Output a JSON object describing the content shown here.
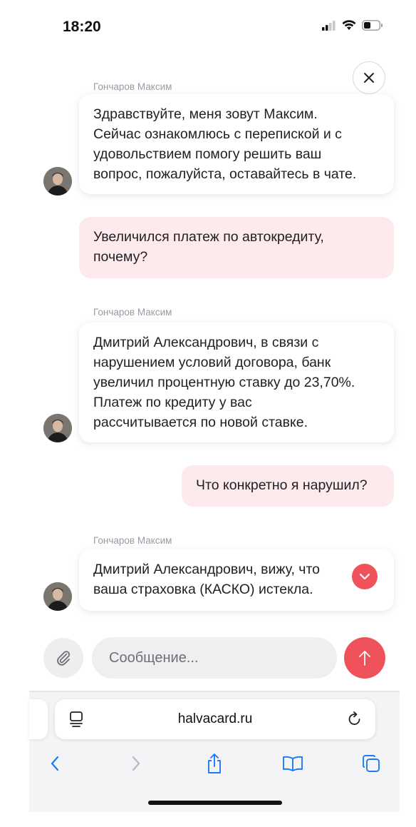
{
  "status_bar": {
    "time": "18:20"
  },
  "chat": {
    "messages": [
      {
        "direction": "in",
        "sender": "Гончаров Максим",
        "lines": [
          "Здравствуйте, меня зовут Максим.",
          "Сейчас ознакомлюсь с перепиской и с",
          "удовольствием помогу решить ваш",
          "вопрос, пожалуйста, оставайтесь в чате."
        ]
      },
      {
        "direction": "out",
        "lines": [
          "Увеличился платеж по автокредиту,",
          "почему?"
        ]
      },
      {
        "direction": "in",
        "sender": "Гончаров Максим",
        "lines": [
          "Дмитрий Александрович, в связи с",
          "нарушением условий договора, банк",
          "увеличил процентную ставку до 23,70%.",
          "Платеж по кредиту у вас",
          "рассчитывается по новой ставке."
        ]
      },
      {
        "direction": "out",
        "lines": [
          "Что конкретно я нарушил?"
        ]
      },
      {
        "direction": "in",
        "sender": "Гончаров Максим",
        "lines": [
          "Дмитрий Александрович, вижу, что",
          "ваша страховка (КАСКО) истекла."
        ]
      }
    ],
    "input": {
      "placeholder": "Сообщение...",
      "value": ""
    },
    "icons": {
      "close": "close-icon",
      "attach": "paperclip-icon",
      "send": "arrow-up-icon",
      "scroll": "chevron-down-icon"
    },
    "colors": {
      "accent": "#f0525c",
      "outgoing_bubble": "#fdeaec",
      "input_bg": "#efeff0",
      "sender_text": "#9a9aa6"
    }
  },
  "browser": {
    "url": "halvacard.ru",
    "toolbar_icons": [
      "back-icon",
      "forward-icon",
      "share-icon",
      "bookmarks-icon",
      "tabs-icon"
    ],
    "accent": "#1a7cf5"
  }
}
